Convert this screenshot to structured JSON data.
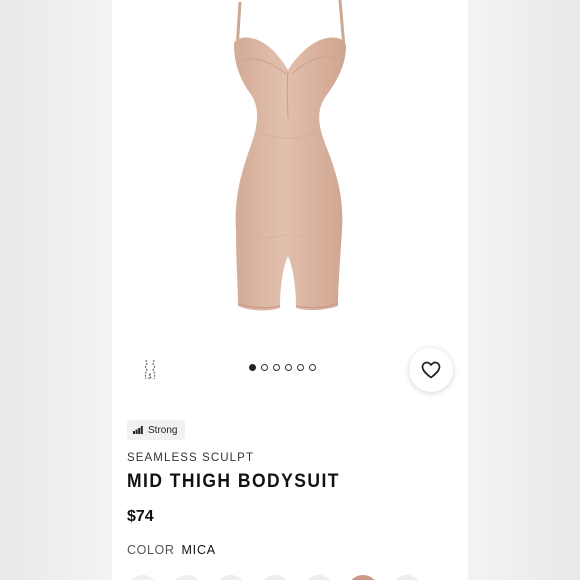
{
  "product": {
    "badge": {
      "label": "Strong",
      "icon": "signal-bars-icon"
    },
    "collection": "SEAMLESS SCULPT",
    "title": "MID THIGH BODYSUIT",
    "price": "$74",
    "color_label": "COLOR",
    "color_value": "MICA"
  },
  "gallery": {
    "image_count": 6,
    "active_index": 0,
    "product_color": "#dcb7a4"
  },
  "swatches": [
    "#f2efee",
    "#f1eeed",
    "#f0edec",
    "#efecec",
    "#efeceb",
    "#c99a86",
    "#efecec"
  ],
  "icons": {
    "model": "body-outline-icon",
    "favorite": "heart-icon"
  }
}
